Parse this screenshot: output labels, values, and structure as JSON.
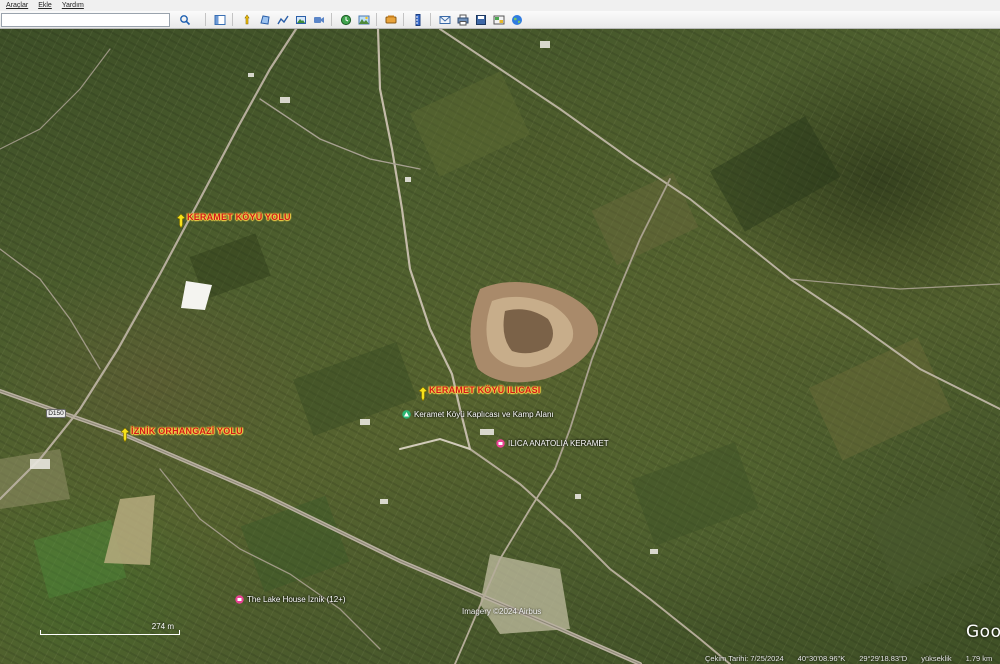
{
  "menu": {
    "items": [
      "Araçlar",
      "Ekle",
      "Yardım"
    ]
  },
  "toolbar": {
    "search_value": "",
    "buttons": [
      {
        "name": "search",
        "icon": "search-icon"
      },
      {
        "name": "sidebar",
        "icon": "sidebar-icon"
      },
      {
        "name": "add-placemark",
        "icon": "placemark-icon"
      },
      {
        "name": "add-polygon",
        "icon": "polygon-icon"
      },
      {
        "name": "add-path",
        "icon": "path-icon"
      },
      {
        "name": "image-overlay",
        "icon": "image-overlay-icon"
      },
      {
        "name": "record-tour",
        "icon": "record-tour-icon"
      },
      {
        "name": "historical-imagery",
        "icon": "historical-imagery-icon"
      },
      {
        "name": "sunlight",
        "icon": "sunlight-icon"
      },
      {
        "name": "switch-planet",
        "icon": "planet-icon"
      },
      {
        "name": "ruler",
        "icon": "ruler-icon"
      },
      {
        "name": "email",
        "icon": "email-icon"
      },
      {
        "name": "print",
        "icon": "print-icon"
      },
      {
        "name": "save-image",
        "icon": "save-image-icon"
      },
      {
        "name": "view-in-maps",
        "icon": "maps-icon"
      },
      {
        "name": "earth",
        "icon": "earth-icon"
      }
    ]
  },
  "map": {
    "placemarks": [
      {
        "label": "KERAMET KÖYÜ YOLU",
        "color": "#d11a1a"
      },
      {
        "label": "KERAMET KÖYÜ ILICASI",
        "color": "#d11a1a"
      },
      {
        "label": "İZNİK ORHANGAZİ YOLU",
        "color": "#d11a1a"
      }
    ],
    "pois": [
      {
        "label": "Keramet Köyü Kaplıcası ve Kamp Alanı",
        "icon": "camp-icon",
        "color": "#2bb673"
      },
      {
        "label": "ILICA ANATOLIA KERAMET",
        "icon": "hotel-icon",
        "color": "#e84393"
      },
      {
        "label": "The Lake House İznik (12+)",
        "icon": "lodging-icon",
        "color": "#e84393"
      }
    ],
    "road_shield": "D150",
    "imagery_credit": "Imagery ©2024 Airbus",
    "scale_label": "274 m",
    "logo": "Google"
  },
  "status": {
    "date": "Çekim Tarihi: 7/25/2024",
    "lat": "40°30'08.96\"K",
    "lon": "29°29'18.83\"D",
    "elevation": "yükseklik",
    "altitude": "1.79 km"
  }
}
